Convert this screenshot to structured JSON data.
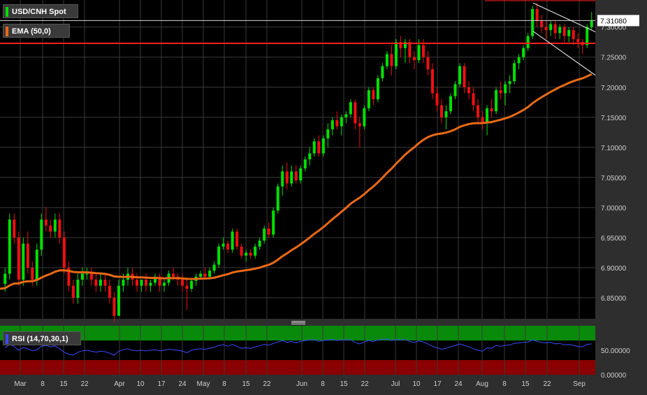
{
  "legend": {
    "symbol": "USD/CNH Spot",
    "ema": "EMA (50,0)",
    "rsi": "RSI (14,70,30,1)"
  },
  "colors": {
    "up": "#00e000",
    "down": "#ee1010",
    "ema": "#e86a17",
    "rsi_line": "#3a4bff",
    "overbought_band": "#0a8a0a",
    "oversold_band": "#8a0000",
    "price_line": "#ff2020",
    "channel": "#ffffff"
  },
  "price_axis": {
    "ticks": [
      "7.30000",
      "7.25000",
      "7.20000",
      "7.15000",
      "7.10000",
      "7.05000",
      "7.00000",
      "6.95000",
      "6.90000",
      "6.85000"
    ],
    "current": "7.31080"
  },
  "rsi_axis": {
    "ticks": [
      "50.00000",
      "0.00000"
    ]
  },
  "time_axis": [
    "Mar",
    "8",
    "15",
    "22",
    "Apr",
    "10",
    "17",
    "24",
    "May",
    "8",
    "15",
    "22",
    "Jun",
    "8",
    "15",
    "22",
    "Jul",
    "10",
    "17",
    "24",
    "Aug",
    "8",
    "15",
    "22",
    "Sep"
  ],
  "chart_data": {
    "type": "candlestick",
    "title": "USD/CNH Spot",
    "y_range": [
      6.815,
      7.345
    ],
    "current_price": 7.3108,
    "resistance_level": 7.273,
    "candles": [
      [
        6.873,
        6.9,
        6.86,
        6.89
      ],
      [
        6.89,
        6.99,
        6.88,
        6.98
      ],
      [
        6.98,
        6.99,
        6.94,
        6.95
      ],
      [
        6.95,
        6.96,
        6.87,
        6.88
      ],
      [
        6.88,
        6.95,
        6.87,
        6.94
      ],
      [
        6.94,
        6.96,
        6.89,
        6.9
      ],
      [
        6.9,
        6.91,
        6.87,
        6.88
      ],
      [
        6.88,
        6.94,
        6.87,
        6.93
      ],
      [
        6.93,
        6.99,
        6.92,
        6.98
      ],
      [
        6.98,
        7.0,
        6.96,
        6.97
      ],
      [
        6.97,
        6.98,
        6.95,
        6.96
      ],
      [
        6.96,
        6.99,
        6.95,
        6.98
      ],
      [
        6.98,
        6.99,
        6.94,
        6.95
      ],
      [
        6.95,
        6.96,
        6.89,
        6.9
      ],
      [
        6.9,
        6.91,
        6.86,
        6.87
      ],
      [
        6.87,
        6.88,
        6.84,
        6.85
      ],
      [
        6.85,
        6.89,
        6.84,
        6.88
      ],
      [
        6.88,
        6.9,
        6.87,
        6.89
      ],
      [
        6.89,
        6.9,
        6.88,
        6.89
      ],
      [
        6.89,
        6.9,
        6.87,
        6.88
      ],
      [
        6.88,
        6.89,
        6.86,
        6.87
      ],
      [
        6.87,
        6.89,
        6.86,
        6.88
      ],
      [
        6.88,
        6.89,
        6.86,
        6.87
      ],
      [
        6.87,
        6.88,
        6.84,
        6.85
      ],
      [
        6.85,
        6.86,
        6.81,
        6.82
      ],
      [
        6.82,
        6.88,
        6.82,
        6.87
      ],
      [
        6.87,
        6.89,
        6.86,
        6.88
      ],
      [
        6.88,
        6.9,
        6.87,
        6.89
      ],
      [
        6.89,
        6.9,
        6.87,
        6.88
      ],
      [
        6.88,
        6.89,
        6.86,
        6.87
      ],
      [
        6.87,
        6.88,
        6.86,
        6.88
      ],
      [
        6.88,
        6.89,
        6.86,
        6.87
      ],
      [
        6.87,
        6.88,
        6.86,
        6.875
      ],
      [
        6.875,
        6.89,
        6.87,
        6.885
      ],
      [
        6.885,
        6.89,
        6.86,
        6.87
      ],
      [
        6.87,
        6.88,
        6.86,
        6.875
      ],
      [
        6.875,
        6.895,
        6.87,
        6.89
      ],
      [
        6.89,
        6.9,
        6.88,
        6.885
      ],
      [
        6.885,
        6.89,
        6.87,
        6.88
      ],
      [
        6.88,
        6.89,
        6.86,
        6.87
      ],
      [
        6.87,
        6.88,
        6.83,
        6.865
      ],
      [
        6.865,
        6.88,
        6.86,
        6.878
      ],
      [
        6.878,
        6.89,
        6.87,
        6.885
      ],
      [
        6.885,
        6.895,
        6.88,
        6.89
      ],
      [
        6.89,
        6.9,
        6.88,
        6.885
      ],
      [
        6.885,
        6.9,
        6.88,
        6.895
      ],
      [
        6.895,
        6.91,
        6.89,
        6.905
      ],
      [
        6.905,
        6.94,
        6.9,
        6.935
      ],
      [
        6.935,
        6.95,
        6.93,
        6.94
      ],
      [
        6.94,
        6.945,
        6.925,
        6.93
      ],
      [
        6.93,
        6.965,
        6.925,
        6.96
      ],
      [
        6.96,
        6.965,
        6.93,
        6.935
      ],
      [
        6.935,
        6.94,
        6.915,
        6.92
      ],
      [
        6.92,
        6.93,
        6.91,
        6.925
      ],
      [
        6.925,
        6.93,
        6.915,
        6.92
      ],
      [
        6.92,
        6.94,
        6.915,
        6.935
      ],
      [
        6.935,
        6.95,
        6.93,
        6.945
      ],
      [
        6.945,
        6.97,
        6.94,
        6.965
      ],
      [
        6.965,
        6.975,
        6.95,
        6.955
      ],
      [
        6.955,
        7.0,
        6.95,
        6.995
      ],
      [
        6.995,
        7.04,
        6.99,
        7.035
      ],
      [
        7.035,
        7.07,
        7.02,
        7.06
      ],
      [
        7.06,
        7.075,
        7.03,
        7.04
      ],
      [
        7.04,
        7.07,
        7.035,
        7.06
      ],
      [
        7.06,
        7.07,
        7.04,
        7.045
      ],
      [
        7.045,
        7.07,
        7.04,
        7.065
      ],
      [
        7.065,
        7.085,
        7.06,
        7.08
      ],
      [
        7.08,
        7.1,
        7.07,
        7.09
      ],
      [
        7.09,
        7.115,
        7.085,
        7.11
      ],
      [
        7.11,
        7.12,
        7.085,
        7.09
      ],
      [
        7.09,
        7.12,
        7.085,
        7.115
      ],
      [
        7.115,
        7.14,
        7.1,
        7.13
      ],
      [
        7.13,
        7.15,
        7.12,
        7.145
      ],
      [
        7.145,
        7.16,
        7.13,
        7.135
      ],
      [
        7.135,
        7.155,
        7.12,
        7.15
      ],
      [
        7.15,
        7.16,
        7.14,
        7.155
      ],
      [
        7.155,
        7.18,
        7.15,
        7.175
      ],
      [
        7.175,
        7.18,
        7.13,
        7.14
      ],
      [
        7.14,
        7.15,
        7.1,
        7.135
      ],
      [
        7.135,
        7.17,
        7.13,
        7.165
      ],
      [
        7.165,
        7.2,
        7.16,
        7.195
      ],
      [
        7.195,
        7.2,
        7.17,
        7.18
      ],
      [
        7.18,
        7.22,
        7.175,
        7.215
      ],
      [
        7.215,
        7.24,
        7.21,
        7.235
      ],
      [
        7.235,
        7.26,
        7.23,
        7.255
      ],
      [
        7.255,
        7.27,
        7.22,
        7.235
      ],
      [
        7.235,
        7.28,
        7.23,
        7.275
      ],
      [
        7.275,
        7.285,
        7.25,
        7.265
      ],
      [
        7.265,
        7.28,
        7.24,
        7.275
      ],
      [
        7.275,
        7.28,
        7.24,
        7.25
      ],
      [
        7.25,
        7.26,
        7.23,
        7.245
      ],
      [
        7.245,
        7.28,
        7.24,
        7.27
      ],
      [
        7.27,
        7.28,
        7.24,
        7.25
      ],
      [
        7.25,
        7.26,
        7.22,
        7.23
      ],
      [
        7.23,
        7.24,
        7.18,
        7.19
      ],
      [
        7.19,
        7.2,
        7.16,
        7.17
      ],
      [
        7.17,
        7.18,
        7.14,
        7.15
      ],
      [
        7.15,
        7.17,
        7.13,
        7.16
      ],
      [
        7.16,
        7.19,
        7.155,
        7.185
      ],
      [
        7.185,
        7.21,
        7.18,
        7.205
      ],
      [
        7.205,
        7.24,
        7.2,
        7.235
      ],
      [
        7.235,
        7.24,
        7.19,
        7.2
      ],
      [
        7.2,
        7.21,
        7.18,
        7.19
      ],
      [
        7.19,
        7.2,
        7.16,
        7.17
      ],
      [
        7.17,
        7.18,
        7.14,
        7.15
      ],
      [
        7.15,
        7.16,
        7.13,
        7.14
      ],
      [
        7.14,
        7.17,
        7.12,
        7.165
      ],
      [
        7.165,
        7.18,
        7.15,
        7.16
      ],
      [
        7.16,
        7.2,
        7.155,
        7.195
      ],
      [
        7.195,
        7.21,
        7.18,
        7.19
      ],
      [
        7.19,
        7.21,
        7.17,
        7.205
      ],
      [
        7.205,
        7.22,
        7.19,
        7.21
      ],
      [
        7.21,
        7.245,
        7.205,
        7.24
      ],
      [
        7.24,
        7.255,
        7.23,
        7.25
      ],
      [
        7.25,
        7.27,
        7.245,
        7.265
      ],
      [
        7.265,
        7.29,
        7.26,
        7.285
      ],
      [
        7.285,
        7.335,
        7.28,
        7.33
      ],
      [
        7.33,
        7.34,
        7.3,
        7.31
      ],
      [
        7.31,
        7.32,
        7.29,
        7.3
      ],
      [
        7.3,
        7.31,
        7.28,
        7.295
      ],
      [
        7.295,
        7.31,
        7.285,
        7.305
      ],
      [
        7.305,
        7.31,
        7.28,
        7.29
      ],
      [
        7.29,
        7.305,
        7.28,
        7.3
      ],
      [
        7.3,
        7.305,
        7.275,
        7.285
      ],
      [
        7.285,
        7.3,
        7.275,
        7.295
      ],
      [
        7.295,
        7.3,
        7.27,
        7.28
      ],
      [
        7.28,
        7.29,
        7.265,
        7.275
      ],
      [
        7.275,
        7.28,
        7.255,
        7.27
      ],
      [
        7.27,
        7.305,
        7.265,
        7.3
      ],
      [
        7.3,
        7.325,
        7.295,
        7.31
      ]
    ],
    "ema_start": 6.865,
    "rsi": [
      55,
      62,
      58,
      50,
      56,
      53,
      49,
      51,
      58,
      60,
      57,
      59,
      53,
      46,
      42,
      40,
      46,
      49,
      50,
      48,
      46,
      48,
      47,
      44,
      40,
      48,
      51,
      53,
      50,
      49,
      50,
      49,
      50,
      51,
      49,
      50,
      52,
      51,
      50,
      48,
      45,
      50,
      52,
      53,
      52,
      54,
      56,
      60,
      61,
      58,
      62,
      58,
      54,
      55,
      54,
      57,
      59,
      62,
      60,
      64,
      67,
      70,
      66,
      68,
      65,
      68,
      70,
      71,
      72,
      68,
      70,
      71,
      72,
      70,
      71,
      71,
      72,
      66,
      63,
      67,
      70,
      68,
      71,
      72,
      73,
      70,
      72,
      71,
      72,
      68,
      66,
      69,
      67,
      63,
      58,
      55,
      52,
      54,
      57,
      60,
      63,
      60,
      57,
      53,
      50,
      48,
      55,
      54,
      60,
      58,
      60,
      61,
      64,
      65,
      66,
      67,
      71,
      68,
      66,
      65,
      66,
      63,
      64,
      61,
      62,
      60,
      58,
      57,
      62,
      63
    ],
    "rsi_levels": {
      "overbought": 70,
      "oversold": 30
    }
  }
}
